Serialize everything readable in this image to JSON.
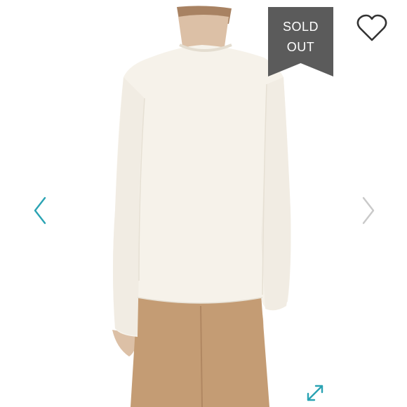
{
  "listing": {
    "status_line1": "SOLD",
    "status_line2": "OUT"
  },
  "colors": {
    "badge": "#5b5b5b",
    "accent": "#2aa3b3",
    "sweater": "#f6f2ea",
    "pants": "#c49c74",
    "skin": "#dcc0a6",
    "hair": "#a88262"
  },
  "icons": {
    "like": "heart-outline-icon",
    "prev": "chevron-left-icon",
    "next": "chevron-right-icon",
    "expand": "expand-arrows-icon"
  }
}
